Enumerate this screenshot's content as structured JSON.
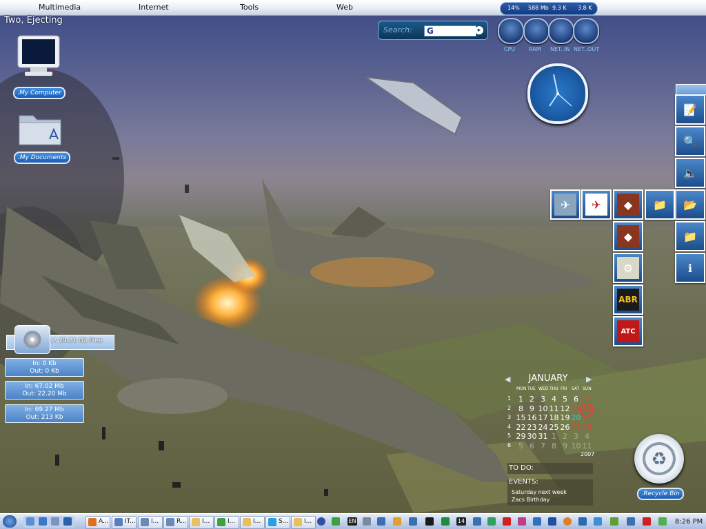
{
  "menubar": {
    "items": [
      "Multimedia",
      "Internet",
      "Tools",
      "Web"
    ]
  },
  "window_title": "Two, Ejecting",
  "search": {
    "label": "Search:",
    "engine_letter": "G"
  },
  "system": {
    "cpu_percent": "14%",
    "ram_used": "588 Mb",
    "net_in": "9.3 K",
    "net_out": "3.8 K",
    "gauges": [
      "CPU",
      "RAM",
      "NET..IN",
      "NET..OUT"
    ]
  },
  "desktop_icons": [
    {
      "label": ".My Computer",
      "icon": "monitor-icon"
    },
    {
      "label": ".My Documents",
      "icon": "folder-icon"
    }
  ],
  "drive": {
    "text": "C:\\ 29.21 Gb Free"
  },
  "net_widgets": [
    {
      "in": "In: 0 Kb",
      "out": "Out: 0 Kb"
    },
    {
      "in": "In: 67.02 Mb",
      "out": "Out: 22.20 Mb"
    },
    {
      "in": "In: 69.27 Mb",
      "out": "Out: 213 Kb"
    }
  ],
  "dock": {
    "right_column": [
      "notepad-icon",
      "search-magnifier-icon",
      "speaker-icon",
      "folder-open-icon",
      "blue-folder-icon",
      "info-icon"
    ],
    "row": [
      "jet-thumbnail-icon",
      "flight-sim-icon",
      "game-icon",
      "folder-icon"
    ],
    "column": [
      {
        "icon": "game-icon"
      },
      {
        "icon": "tool-icon"
      },
      {
        "icon": "abr-icon",
        "text": "ABR"
      },
      {
        "icon": "atc-icon",
        "text": "ATC"
      }
    ]
  },
  "calendar": {
    "month": "JANUARY",
    "year": "2007",
    "days_of_week": [
      "MON",
      "TUE",
      "WED",
      "THU",
      "FRI",
      "SAT",
      "SUN"
    ],
    "weeks": [
      {
        "num": "1",
        "days": [
          "1",
          "2",
          "3",
          "4",
          "5",
          "6",
          "7"
        ]
      },
      {
        "num": "2",
        "days": [
          "8",
          "9",
          "10",
          "11",
          "12",
          "13",
          "14"
        ]
      },
      {
        "num": "3",
        "days": [
          "15",
          "16",
          "17",
          "18",
          "19",
          "20",
          "21"
        ]
      },
      {
        "num": "4",
        "days": [
          "22",
          "23",
          "24",
          "25",
          "26",
          "27",
          "28"
        ]
      },
      {
        "num": "5",
        "days": [
          "29",
          "30",
          "31",
          "1",
          "2",
          "3",
          "4"
        ]
      },
      {
        "num": "6",
        "days": [
          "5",
          "6",
          "7",
          "8",
          "9",
          "10",
          "11"
        ]
      }
    ],
    "today": "14",
    "todo_label": "TO DO:",
    "events_label": "EVENTS:",
    "events": [
      "Saturday next week",
      "Zacs Birthday"
    ]
  },
  "recycle_bin": {
    "label": ".Recycle Bin"
  },
  "taskbar": {
    "buttons": [
      "A...",
      "IT...",
      "I...",
      "R...",
      "I...",
      "I...",
      "I...",
      "S...",
      "I..."
    ],
    "tray_text": [
      "EN",
      "14"
    ],
    "time": "8:26 PM"
  },
  "colors": {
    "menu_bar": "#e9edf6",
    "accent_blue": "#1c5cb3",
    "calendar_today": "#e0443a",
    "calendar_sunday_alt": "#37c3d9"
  }
}
